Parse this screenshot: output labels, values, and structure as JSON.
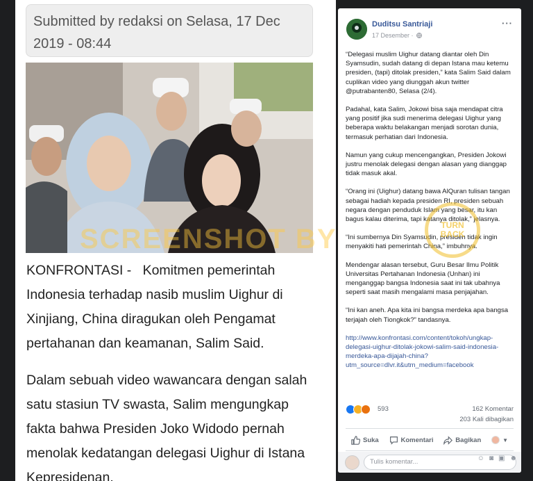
{
  "article": {
    "submitted": "Submitted by redaksi on Selasa, 17 Dec 2019 - 08:44",
    "kicker": "KONFRONTASI -",
    "para1": "Komitmen pemerintah Indonesia terhadap nasib muslim Uighur di Xinjiang, China diragukan oleh Pengamat pertahanan dan keamanan, Salim Said.",
    "para2": "Dalam sebuah video wawancara dengan salah satu stasiun TV swasta, Salim mengungkap fakta bahwa Presiden Joko Widodo pernah menolak kedatangan delegasi Uighur di Istana Kepresidenan."
  },
  "post": {
    "author": "Duditsu Santriaji",
    "date": "17 Desember ·",
    "more": "···",
    "paragraphs": [
      "“Delegasi muslim Uighur datang diantar oleh Din Syamsudin, sudah datang di depan Istana mau ketemu presiden, (tapi) ditolak presiden,” kata Salim Said dalam cuplikan video yang diunggah akun twitter @putrabanten80, Selasa (2/4).",
      "Padahal, kata Salim, Jokowi bisa saja mendapat citra yang positif jika sudi menerima delegasi Uighur yang beberapa waktu belakangan menjadi sorotan dunia, termasuk perhatian dari Indonesia.",
      "Namun yang cukup mencengangkan, Presiden Jokowi justru menolak delegasi dengan alasan yang dianggap tidak masuk akal.",
      "“Orang ini (Uighur) datang bawa AlQuran tulisan tangan sebagai hadiah kepada presiden RI, presiden sebuah negara dengan penduduk Islam yang besar, itu kan bagus kalau diterima, tapi katanya ditolak,” jelasnya.",
      "“Ini sumbernya Din Syamsudin, presiden tidak ingin menyakiti hati pemerintah China,” imbuhnya.",
      "Mendengar alasan tersebut, Guru Besar Ilmu Politik Universitas Pertahanan Indonesia (Unhan) ini menganggap bangsa Indonesia saat ini tak ubahnya seperti saat masih mengalami masa penjajahan.",
      "“Ini kan aneh. Apa kita ini bangsa merdeka apa bangsa terjajah oleh Tiongkok?” tandasnya."
    ],
    "link": "http://www.konfrontasi.com/content/tokoh/ungkap-delegasi-uighur-ditolak-jokowi-salim-said-indonesia-merdeka-apa-dijajah-china?utm_source=dlvr.it&utm_medium=facebook",
    "reaction_count": "593",
    "comment_count": "162 Komentar",
    "share_count": "203 Kali dibagikan",
    "actions": {
      "like": "Suka",
      "comment": "Komentari",
      "share": "Bagikan"
    },
    "comment_placeholder": "Tulis komentar..."
  },
  "overlays": {
    "watermark": "SCREENSHOT BY",
    "seal_line1": "TURN",
    "seal_line2": "BACK"
  },
  "colors": {
    "fb_link": "#385898",
    "page_bg": "#1d1e20"
  }
}
